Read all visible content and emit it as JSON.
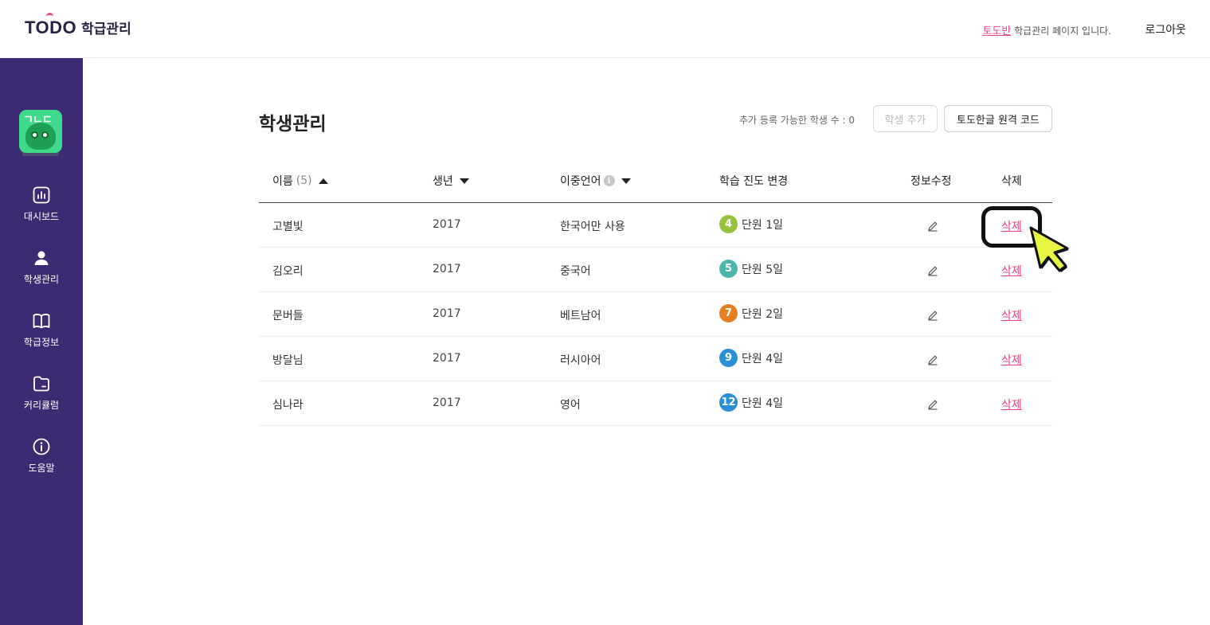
{
  "header": {
    "logo_main": "TODO",
    "logo_sub": "학급관리",
    "class_name": "토도반",
    "message_suffix": " 학급관리 페이지 입니다.",
    "logout_label": "로그아웃"
  },
  "sidebar": {
    "avatar_text": "ㄱㄴㄷ",
    "items": [
      {
        "label": "대시보드",
        "icon": "dashboard-icon"
      },
      {
        "label": "학생관리",
        "icon": "person-icon"
      },
      {
        "label": "학급정보",
        "icon": "book-icon"
      },
      {
        "label": "커리큘럼",
        "icon": "folder-icon"
      },
      {
        "label": "도움말",
        "icon": "info-icon"
      }
    ]
  },
  "main": {
    "title": "학생관리",
    "available_text": "추가 등록 가능한 학생 수 : 0",
    "add_button": "학생 추가",
    "code_button": "토도한글 원격 코드"
  },
  "table": {
    "headers": {
      "name": "이름",
      "count": "(5)",
      "year": "생년",
      "lang": "이중언어",
      "progress": "학습 진도 변경",
      "edit": "정보수정",
      "delete": "삭제"
    },
    "rows": [
      {
        "name": "고별빛",
        "year": "2017",
        "lang": "한국어만 사용",
        "level": "4",
        "level_color": "#97c23c",
        "progress": "단원 1일",
        "delete": "삭제"
      },
      {
        "name": "김오리",
        "year": "2017",
        "lang": "중국어",
        "level": "5",
        "level_color": "#4db6ac",
        "progress": "단원 5일",
        "delete": "삭제"
      },
      {
        "name": "문버들",
        "year": "2017",
        "lang": "베트남어",
        "level": "7",
        "level_color": "#e67e22",
        "progress": "단원 2일",
        "delete": "삭제"
      },
      {
        "name": "방달님",
        "year": "2017",
        "lang": "러시아어",
        "level": "9",
        "level_color": "#2b8fd6",
        "progress": "단원 4일",
        "delete": "삭제"
      },
      {
        "name": "심나라",
        "year": "2017",
        "lang": "영어",
        "level": "12",
        "level_color": "#2b8fd6",
        "progress": "단원 4일",
        "delete": "삭제"
      }
    ]
  },
  "colors": {
    "sidebar": "#3c2b72",
    "accent": "#e8448d"
  }
}
